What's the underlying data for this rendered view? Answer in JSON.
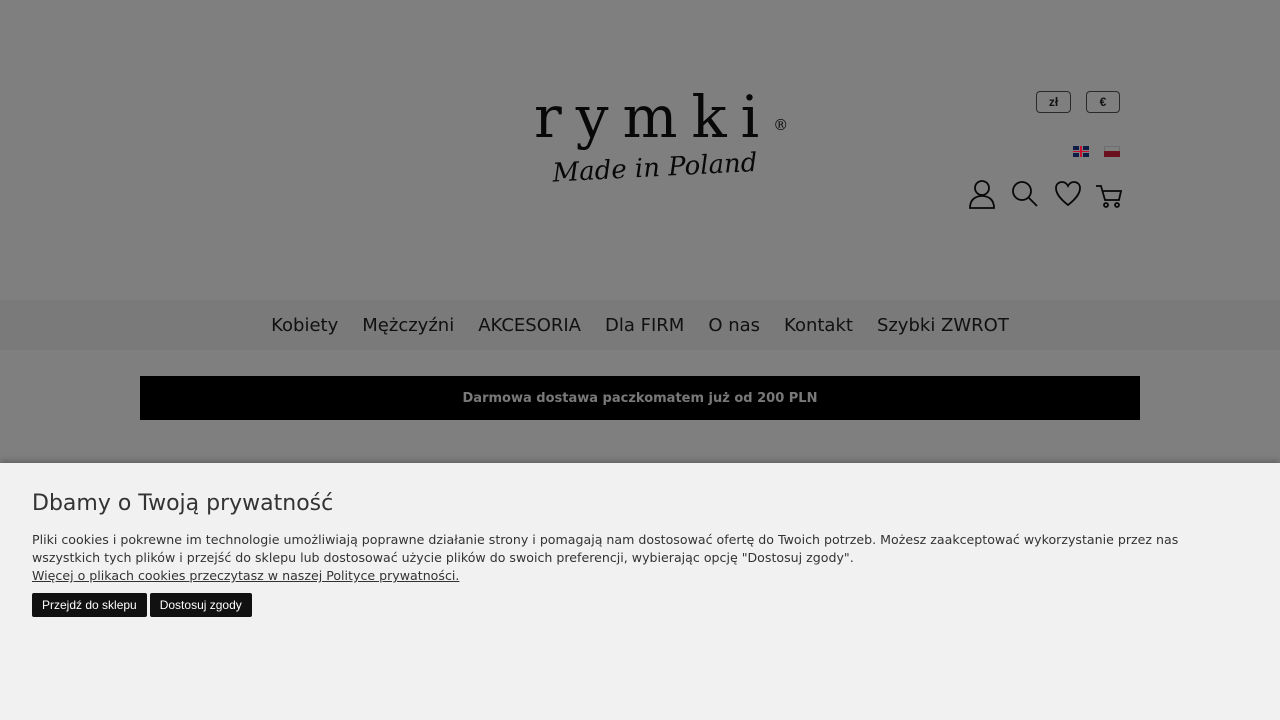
{
  "header": {
    "logo": {
      "wordmark": "rymki",
      "registered": "®",
      "tagline": "Made in Poland"
    },
    "currency": [
      {
        "label": "zł"
      },
      {
        "label": "€"
      }
    ],
    "languages": [
      {
        "code": "en",
        "icon": "flag-gb-icon"
      },
      {
        "code": "pl",
        "icon": "flag-pl-icon"
      }
    ],
    "icons": [
      "user-icon",
      "search-icon",
      "heart-icon",
      "cart-icon"
    ]
  },
  "nav": {
    "items": [
      {
        "label": "Kobiety"
      },
      {
        "label": "Mężczyźni"
      },
      {
        "label": "AKCESORIA"
      },
      {
        "label": "Dla FIRM"
      },
      {
        "label": "O nas"
      },
      {
        "label": "Kontakt"
      },
      {
        "label": "Szybki ZWROT"
      }
    ]
  },
  "promo": {
    "text": "Darmowa dostawa paczkomatem już od 200 PLN"
  },
  "cookie": {
    "title": "Dbamy o Twoją prywatność",
    "body": "Pliki cookies i pokrewne im technologie umożliwiają poprawne działanie strony i pomagają nam dostosować ofertę do Twoich potrzeb. Możesz zaakceptować wykorzystanie przez nas wszystkich tych plików i przejść do sklepu lub dostosować użycie plików do swoich preferencji, wybierając opcję \"Dostosuj zgody\".",
    "link": "Więcej o plikach cookies przeczytasz w naszej Polityce prywatności.",
    "accept_button": "Przejdź do sklepu",
    "customize_button": "Dostosuj zgody"
  },
  "colors": {
    "overlay": "#808080",
    "cookie_bg": "#f1f1f1",
    "promo_bg": "#000000",
    "button_bg": "#111111"
  }
}
